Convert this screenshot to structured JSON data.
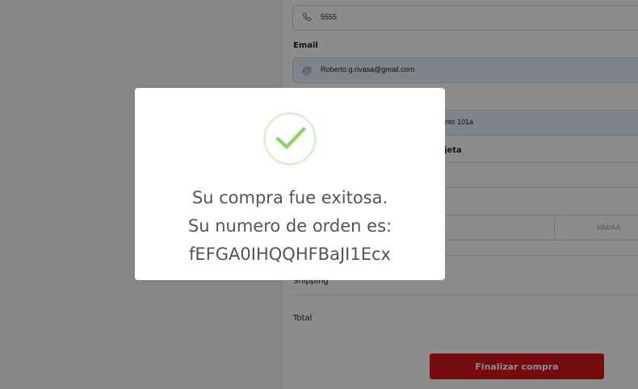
{
  "form": {
    "phone_value": "5555",
    "email_label": "Email",
    "email_value": "Roberto.g.rivasa@gmail.com",
    "address_value_visible": "nto 101a",
    "card_label_visible": "jeta",
    "expiry_placeholder": "MM/AA",
    "shipping_label": "Shipping",
    "total_label": "Total",
    "finalize_button": "Finalizar compra"
  },
  "modal": {
    "line1": "Su compra fue exitosa.",
    "line2": "Su numero de orden es:",
    "order_number": "fEFGA0IHQQHFBaJI1Ecx"
  },
  "colors": {
    "accent": "#d4141b",
    "success": "#8cd46a",
    "success_ring": "#dbf0d2",
    "overlay": "rgba(0,0,0,0.45)"
  },
  "icons": [
    "phone-icon",
    "at-icon",
    "check-icon"
  ]
}
